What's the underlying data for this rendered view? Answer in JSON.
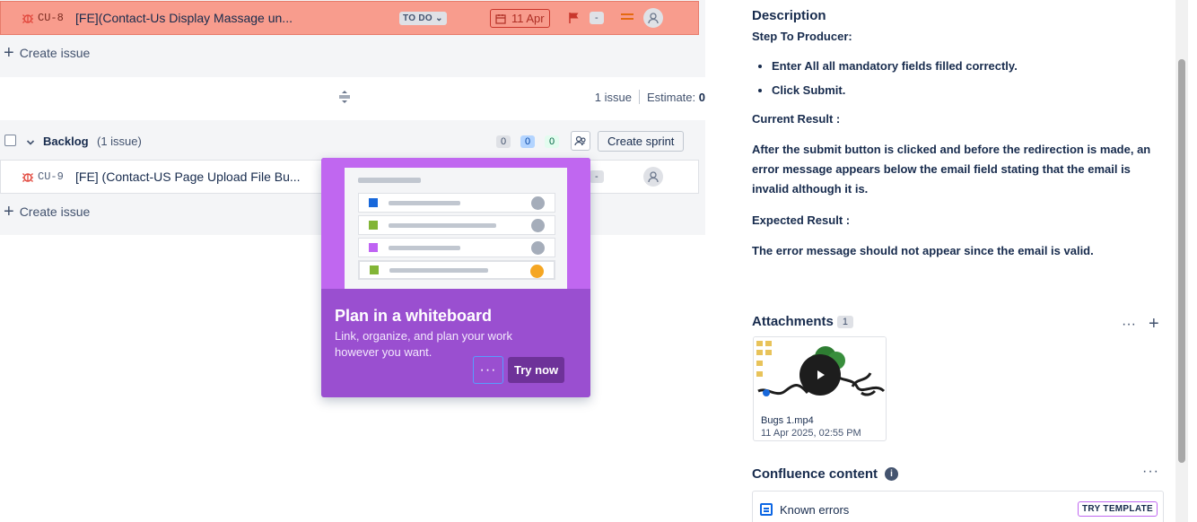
{
  "sprint": {
    "issue": {
      "key": "CU-8",
      "summary": "[FE](Contact-Us Display Massage un...",
      "status": "TO DO",
      "due_date": "11 Apr",
      "estimate": "-"
    },
    "create_issue": "Create issue",
    "footer": {
      "issue_count": "1 issue",
      "estimate_label": "Estimate:",
      "estimate_value": "0"
    }
  },
  "backlog": {
    "title": "Backlog",
    "count": "(1 issue)",
    "pills": [
      "0",
      "0",
      "0"
    ],
    "create_sprint": "Create sprint",
    "issue": {
      "key": "CU-9",
      "summary": "[FE] (Contact-US Page Upload File Bu...",
      "estimate": "-"
    },
    "create_issue": "Create issue"
  },
  "popup": {
    "title": "Plan in a whiteboard",
    "body": "Link, organize, and plan your work however you want.",
    "more": "···",
    "cta": "Try now"
  },
  "details": {
    "description_title": "Description",
    "steps_label": "Step To Producer:",
    "steps": [
      "Enter All all mandatory fields filled correctly.",
      "Click Submit."
    ],
    "current_label": "Current Result :",
    "current_text": "After the submit button is clicked and before the redirection is made, an error message appears below the email field stating that the email is invalid although it is.",
    "expected_label": "Expected Result :",
    "expected_text": "The error message should not appear since the email is valid.",
    "attachments_title": "Attachments",
    "attachments_count": "1",
    "attachment": {
      "name": "Bugs 1.mp4",
      "date": "11 Apr 2025, 02:55 PM"
    },
    "confluence_title": "Confluence content",
    "confluence_item": "Known errors",
    "try_template": "TRY TEMPLATE"
  },
  "colors": {
    "highlight_row": "#f89c8d",
    "popup_bg": "#9a4fd0",
    "popup_hero": "#c067f0",
    "cta_bg": "#6e3299",
    "flag": "#c9372c",
    "priority": "#e56910"
  }
}
